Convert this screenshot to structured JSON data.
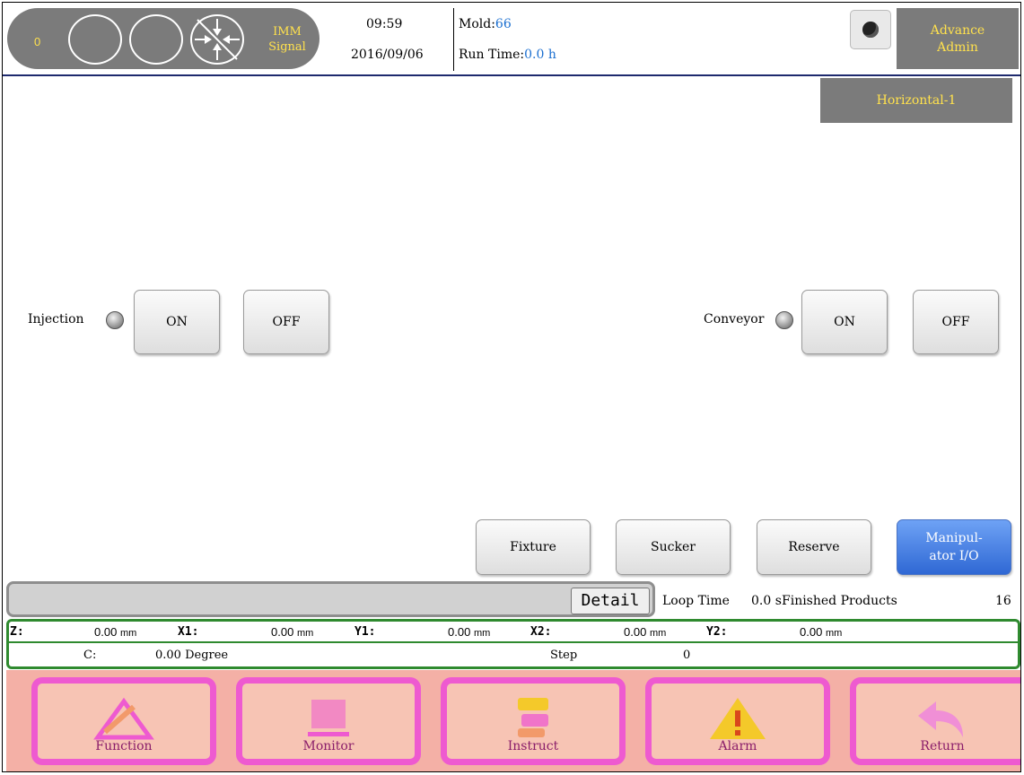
{
  "header": {
    "signal_count": "0",
    "imm_signal_label_line1": "IMM",
    "imm_signal_label_line2": "Signal",
    "time": "09:59",
    "date": "2016/09/06",
    "mold_label": "Mold:",
    "mold_value": "66",
    "runtime_label": "Run Time:",
    "runtime_value": "0.0 h",
    "user_line1": "Advance",
    "user_line2": "Admin"
  },
  "mode": "Horizontal-1",
  "io": {
    "injection": {
      "label": "Injection",
      "on": "ON",
      "off": "OFF"
    },
    "conveyor": {
      "label": "Conveyor",
      "on": "ON",
      "off": "OFF"
    }
  },
  "tabs": [
    {
      "label": "Fixture"
    },
    {
      "label": "Sucker"
    },
    {
      "label": "Reserve"
    },
    {
      "label_line1": "Manipul-",
      "label_line2": "ator I/O"
    }
  ],
  "status": {
    "detail": "Detail",
    "loop_time_label": "Loop Time",
    "loop_time_value": "0.0 s",
    "finished_label": "Finished Products",
    "finished_value": "16"
  },
  "axes": [
    {
      "name": "Z:",
      "value": "0.00",
      "unit": "mm"
    },
    {
      "name": "X1:",
      "value": "0.00",
      "unit": "mm"
    },
    {
      "name": "Y1:",
      "value": "0.00",
      "unit": "mm"
    },
    {
      "name": "X2:",
      "value": "0.00",
      "unit": "mm"
    },
    {
      "name": "Y2:",
      "value": "0.00",
      "unit": "mm"
    }
  ],
  "row2": {
    "c_label": "C:",
    "c_value": "0.00 Degree",
    "step_label": "Step",
    "step_value": "0"
  },
  "nav": [
    {
      "label": "Function",
      "icon": "function-icon"
    },
    {
      "label": "Monitor",
      "icon": "monitor-icon"
    },
    {
      "label": "Instruct",
      "icon": "instruct-icon"
    },
    {
      "label": "Alarm",
      "icon": "warning-icon"
    },
    {
      "label": "Return",
      "icon": "return-icon"
    }
  ],
  "colors": {
    "header_gray": "#7b7b7b",
    "header_text": "#ffe14d",
    "value_blue": "#1b6fd0",
    "axis_green": "#2f8a2f",
    "active_tab": "#2f68d4",
    "nav_border": "#ee5ad0"
  }
}
